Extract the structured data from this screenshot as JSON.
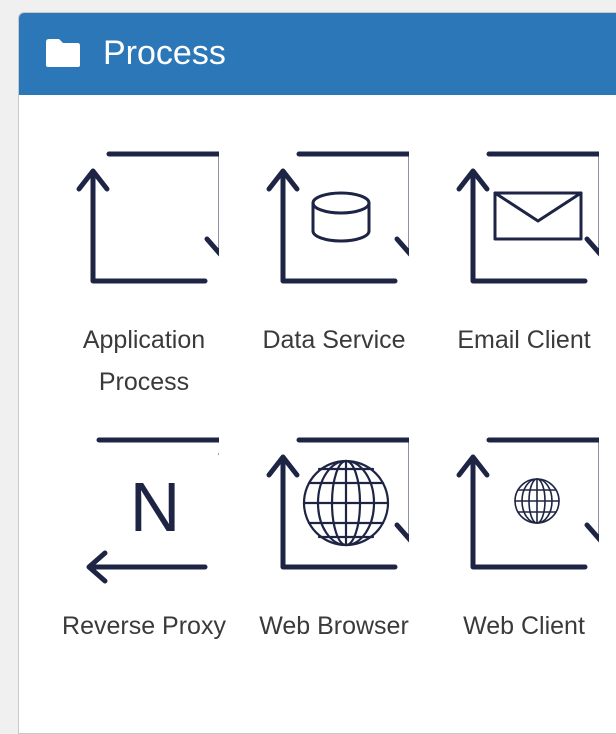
{
  "panel": {
    "title": "Process",
    "folder_icon": "folder-icon"
  },
  "colors": {
    "header": "#2c77b8",
    "icon_stroke": "#1e2544",
    "label": "#3a3a3a"
  },
  "tiles": [
    {
      "label": "Application Process",
      "icon": "application-process-icon"
    },
    {
      "label": "Data Service",
      "icon": "database-icon"
    },
    {
      "label": "Email Client",
      "icon": "envelope-icon"
    },
    {
      "label": "Reverse Proxy",
      "icon": "reverse-proxy-icon",
      "glyph_text": "N"
    },
    {
      "label": "Web Browser",
      "icon": "globe-icon"
    },
    {
      "label": "Web Client",
      "icon": "small-globe-icon"
    }
  ]
}
